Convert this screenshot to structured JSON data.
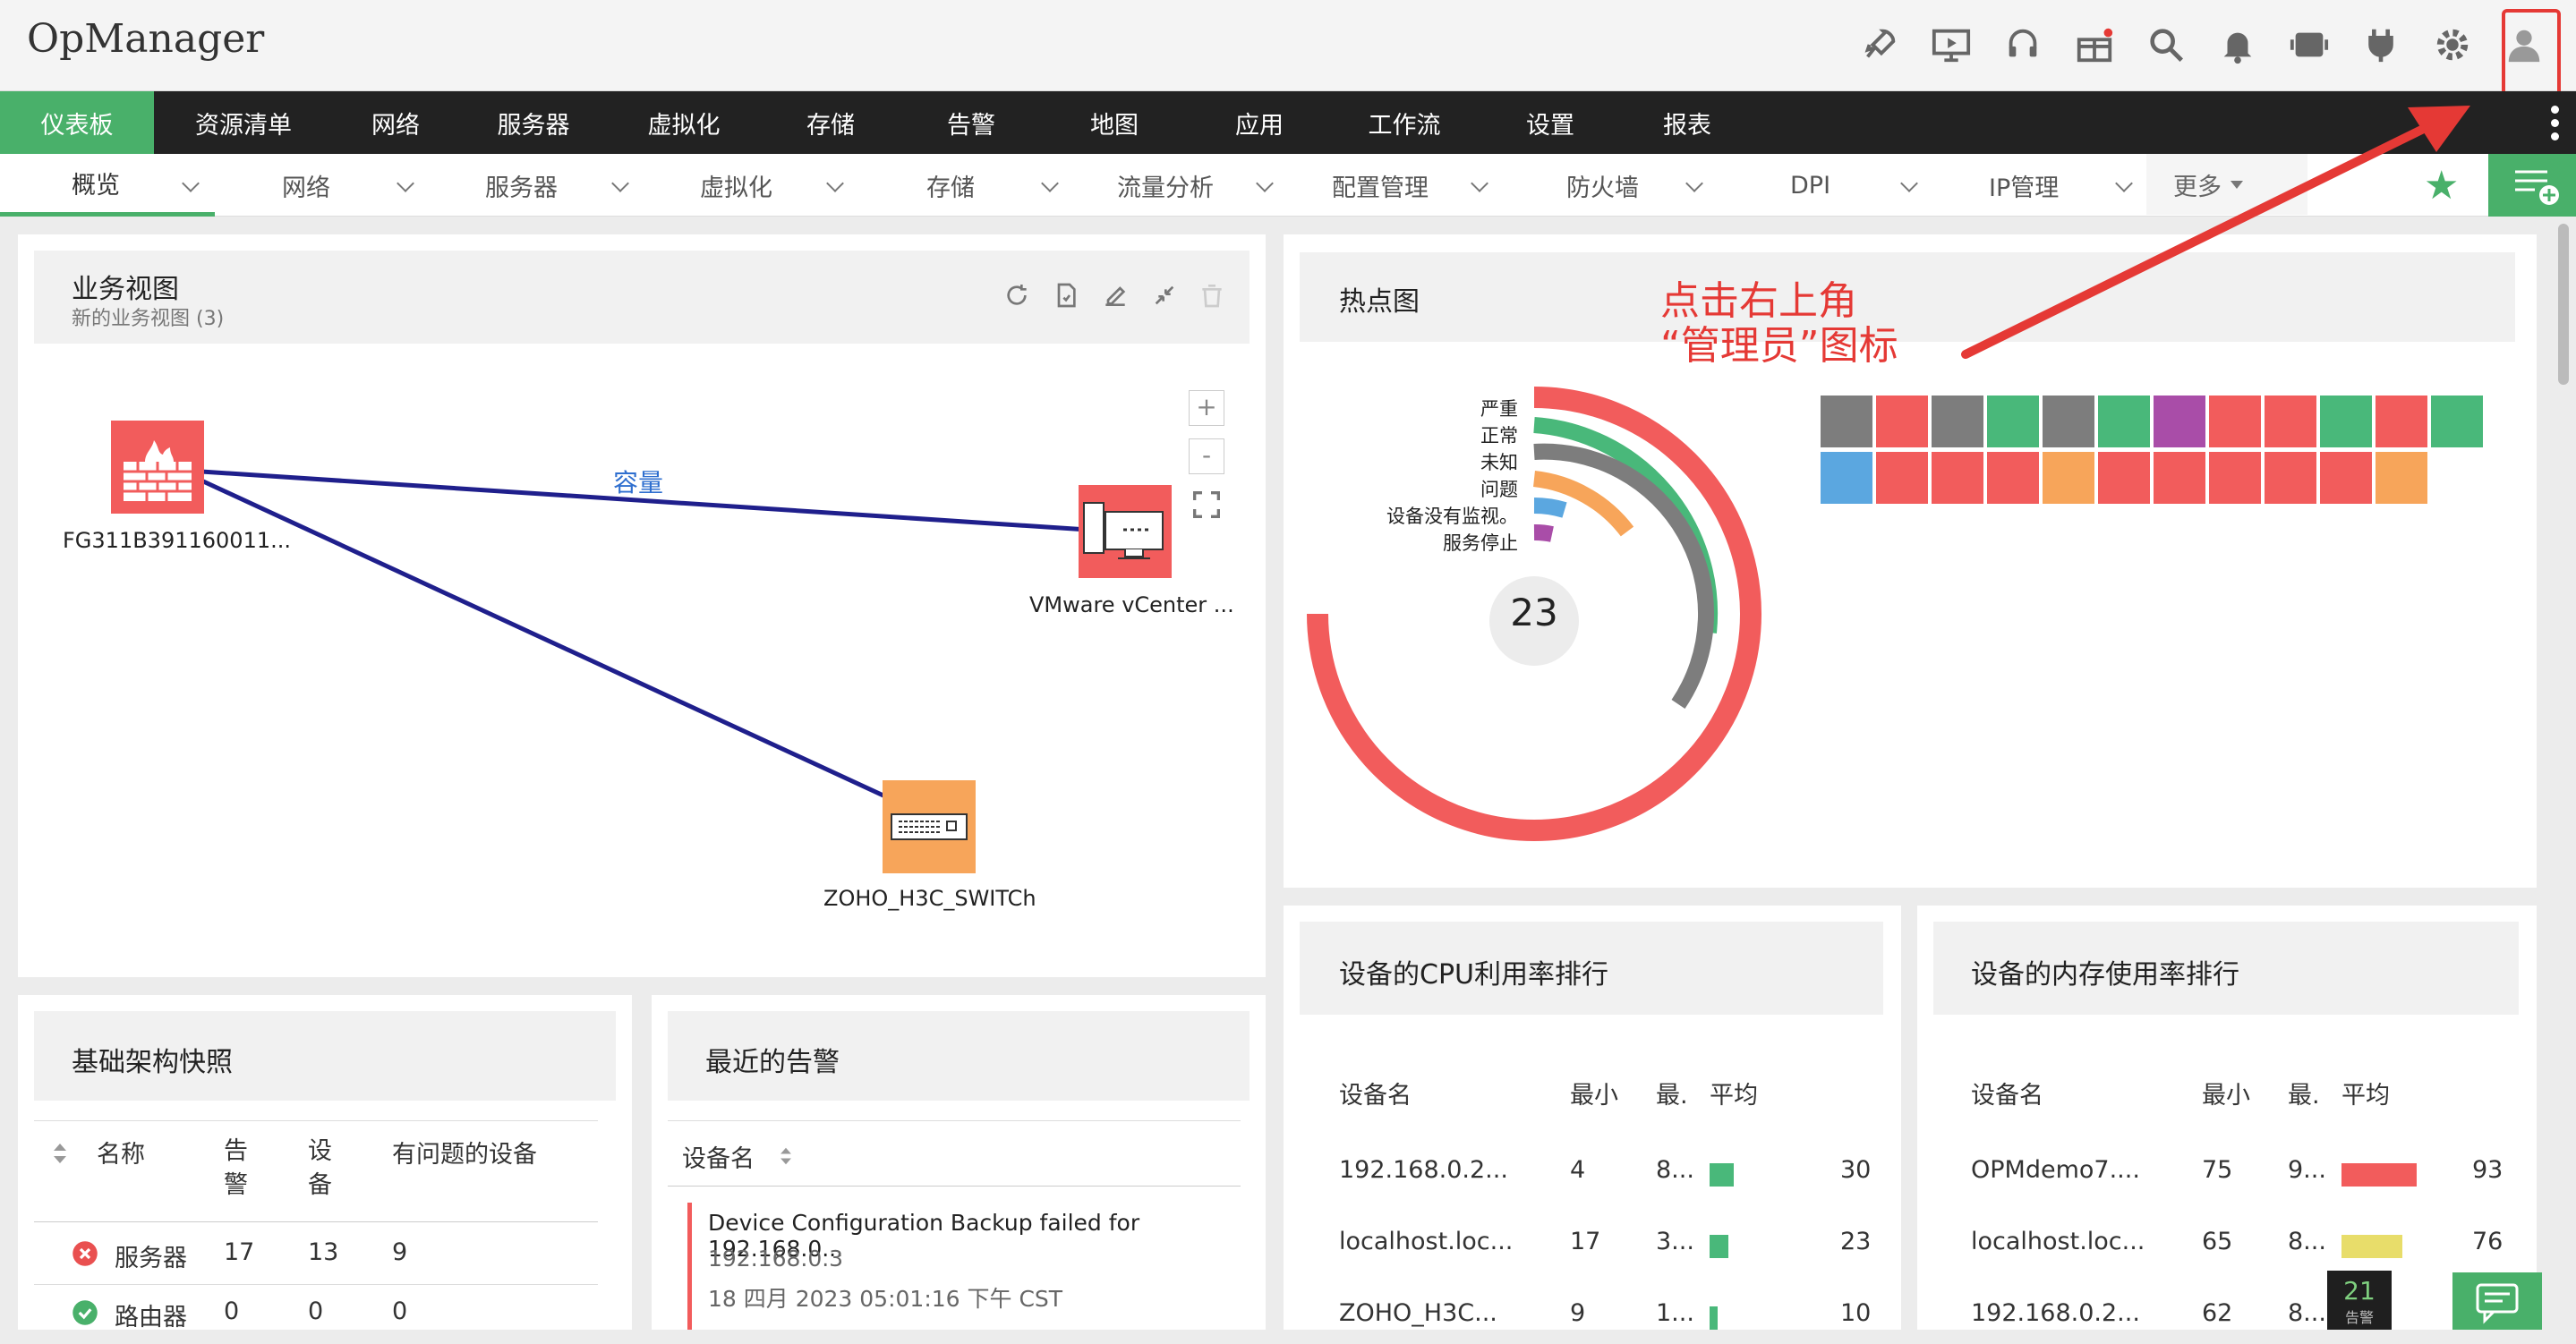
{
  "app": {
    "title": "OpManager"
  },
  "topbar": {
    "icons": [
      "rocket-icon",
      "presentation-icon",
      "headset-icon",
      "gift-icon",
      "search-icon",
      "bell-icon",
      "battery-icon",
      "plug-icon",
      "gear-icon",
      "user-avatar-icon"
    ]
  },
  "mainnav": {
    "items": [
      {
        "label": "仪表板",
        "active": true
      },
      {
        "label": "资源清单"
      },
      {
        "label": "网络"
      },
      {
        "label": "服务器"
      },
      {
        "label": "虚拟化"
      },
      {
        "label": "存储"
      },
      {
        "label": "告警"
      },
      {
        "label": "地图"
      },
      {
        "label": "应用"
      },
      {
        "label": "工作流"
      },
      {
        "label": "设置"
      },
      {
        "label": "报表"
      }
    ]
  },
  "subnav": {
    "items": [
      "概览",
      "网络",
      "服务器",
      "虚拟化",
      "存储",
      "流量分析",
      "配置管理",
      "防火墙",
      "DPI",
      "IP管理"
    ],
    "more": "更多"
  },
  "business_view": {
    "title": "业务视图",
    "subtitle": "新的业务视图 (3)",
    "link_label": "容量",
    "zoom_in": "+",
    "zoom_out": "-",
    "nodes": [
      {
        "label": "FG311B391160011..."
      },
      {
        "label": "VMware vCenter ..."
      },
      {
        "label": "ZOHO_H3C_SWITCh"
      }
    ]
  },
  "heatmap": {
    "title": "热点图",
    "total": "23",
    "legend": [
      "严重",
      "正常",
      "未知",
      "问题",
      "设备没有监视。",
      "服务停止"
    ],
    "colors": {
      "critical": "#f25c5c",
      "clear": "#49b87a",
      "unknown": "#7d7d7d",
      "trouble": "#f7a55a",
      "unmanaged": "#5ba7e0",
      "down": "#a94da8"
    },
    "cells_row1": [
      "unknown",
      "critical",
      "unknown",
      "clear",
      "unknown",
      "clear",
      "down",
      "critical",
      "critical",
      "clear",
      "critical",
      "clear"
    ],
    "cells_row2": [
      "unmanaged",
      "critical",
      "critical",
      "critical",
      "trouble",
      "critical",
      "critical",
      "critical",
      "critical",
      "critical",
      "trouble"
    ]
  },
  "annotation": {
    "line1": "点击右上角",
    "line2": "“管理员”图标"
  },
  "infra": {
    "title": "基础架构快照",
    "headers": [
      "名称",
      "告警",
      "设备",
      "有问题的设备"
    ],
    "header_lines": {
      "alarm": [
        "告",
        "警"
      ],
      "device": [
        "设",
        "备"
      ]
    },
    "rows": [
      {
        "name": "服务器",
        "alarms": "17",
        "devices": "13",
        "problem": "9",
        "status": "error"
      },
      {
        "name": "路由器",
        "alarms": "0",
        "devices": "0",
        "problem": "0",
        "status": "ok"
      }
    ]
  },
  "alarms": {
    "title": "最近的告警",
    "header": "设备名",
    "items": [
      {
        "message": "Device Configuration Backup failed for 192.168.0...",
        "ip": "192.168.0.3",
        "time": "18 四月 2023 05:01:16 下午 CST"
      }
    ]
  },
  "cpu": {
    "title": "设备的CPU利用率排行",
    "headers": [
      "设备名",
      "最小",
      "最.",
      "平均"
    ],
    "rows": [
      {
        "name": "192.168.0.2...",
        "min": "4",
        "max": "8...",
        "avg": "30",
        "color": "#49b87a"
      },
      {
        "name": "localhost.loc...",
        "min": "17",
        "max": "3...",
        "avg": "23",
        "color": "#49b87a"
      },
      {
        "name": "ZOHO_H3C...",
        "min": "9",
        "max": "1...",
        "avg": "10",
        "color": "#49b87a"
      }
    ]
  },
  "mem": {
    "title": "设备的内存使用率排行",
    "headers": [
      "设备名",
      "最小",
      "最.",
      "平均"
    ],
    "rows": [
      {
        "name": "OPMdemo7....",
        "min": "75",
        "max": "9...",
        "avg": "93",
        "color": "#f25c5c"
      },
      {
        "name": "localhost.loc...",
        "min": "65",
        "max": "8...",
        "avg": "76",
        "color": "#e8dd6a"
      },
      {
        "name": "192.168.0.2...",
        "min": "62",
        "max": "8...",
        "avg": "",
        "color": "#e8dd6a"
      }
    ]
  },
  "footer": {
    "alarm_count": "21",
    "alarm_label": "告警"
  }
}
